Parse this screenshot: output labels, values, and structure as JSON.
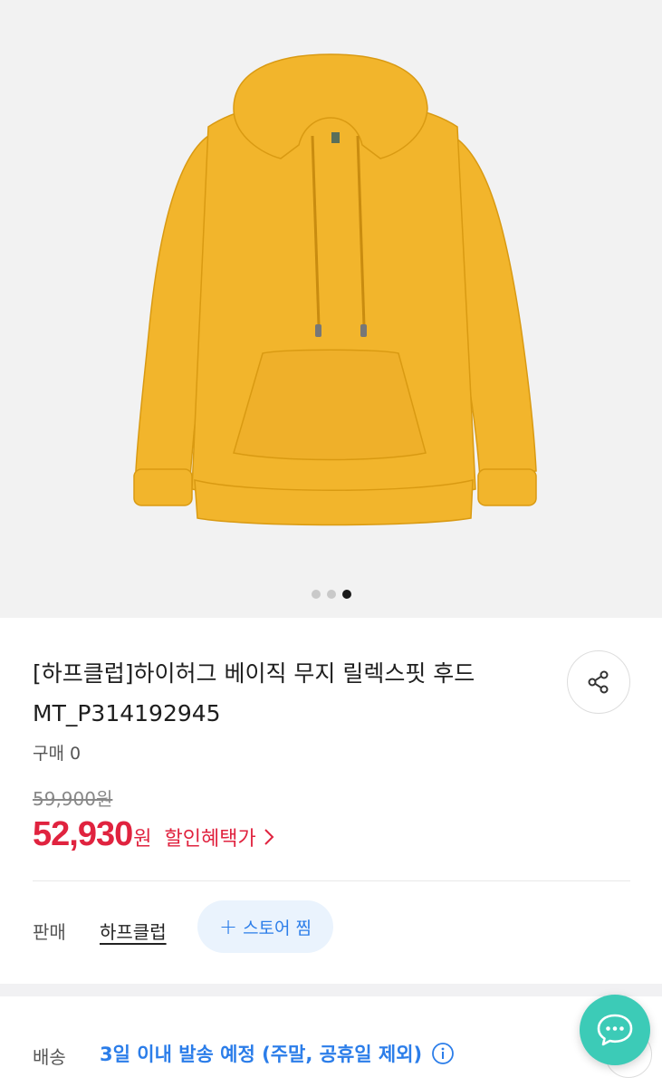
{
  "product": {
    "title_line1": "[하프클럽]하이허그 베이직 무지 릴렉스핏 후드",
    "title_line2": "MT_P314192945",
    "purchase_count": "구매 0",
    "original_price": "59,900원",
    "sale_price": "52,930",
    "sale_currency": "원",
    "benefit_label": "할인혜택가",
    "image_color": "#f2b52c",
    "carousel": {
      "total": 3,
      "active_index": 2
    }
  },
  "seller": {
    "label": "판매",
    "name": "하프클럽",
    "follow_label": "스토어 찜"
  },
  "delivery": {
    "label": "배송",
    "text": "3일 이내 발송 예정 (주말, 공휴일 제외)"
  },
  "colors": {
    "price_red": "#e0233f",
    "link_blue": "#2b7de9",
    "chat_teal": "#3ccbb7"
  },
  "icons": {
    "share": "share-icon",
    "chevron": "chevron-right-icon",
    "plus": "plus-icon",
    "info": "info-circle-icon",
    "chat": "chat-bubble-icon"
  }
}
